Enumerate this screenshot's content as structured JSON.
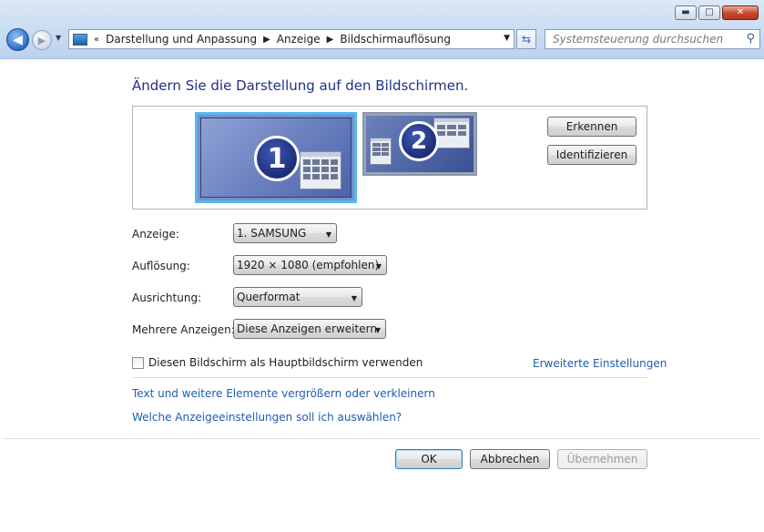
{
  "window": {
    "controls": {
      "minimize": "▬",
      "maximize": "□",
      "close": "✕"
    }
  },
  "nav": {
    "back_glyph": "◀",
    "forward_glyph": "▶",
    "breadcrumb_overflow": "«",
    "breadcrumbs": [
      "Darstellung und Anpassung",
      "Anzeige",
      "Bildschirmauflösung"
    ],
    "search_placeholder": "Systemsteuerung durchsuchen"
  },
  "page": {
    "heading": "Ändern Sie die Darstellung auf den Bildschirmen.",
    "monitors": [
      {
        "number": "1",
        "selected": true
      },
      {
        "number": "2",
        "selected": false
      }
    ],
    "detect_button": "Erkennen",
    "identify_button": "Identifizieren",
    "fields": {
      "display": {
        "label": "Anzeige:",
        "value": "1. SAMSUNG"
      },
      "resolution": {
        "label": "Auflösung:",
        "value": "1920 × 1080 (empfohlen)"
      },
      "orientation": {
        "label": "Ausrichtung:",
        "value": "Querformat"
      },
      "multiple": {
        "label": "Mehrere Anzeigen:",
        "value": "Diese Anzeigen erweitern"
      }
    },
    "primary_checkbox": {
      "label": "Diesen Bildschirm als Hauptbildschirm verwenden",
      "checked": false
    },
    "advanced_link": "Erweiterte Einstellungen",
    "links": [
      "Text und weitere Elemente vergrößern oder verkleinern",
      "Welche Anzeigeeinstellungen soll ich auswählen?"
    ],
    "buttons": {
      "ok": "OK",
      "cancel": "Abbrechen",
      "apply": "Übernehmen"
    }
  },
  "colors": {
    "heading": "#1e3287",
    "link": "#1f5cb3",
    "selected_monitor_border": "#56b8f0"
  }
}
